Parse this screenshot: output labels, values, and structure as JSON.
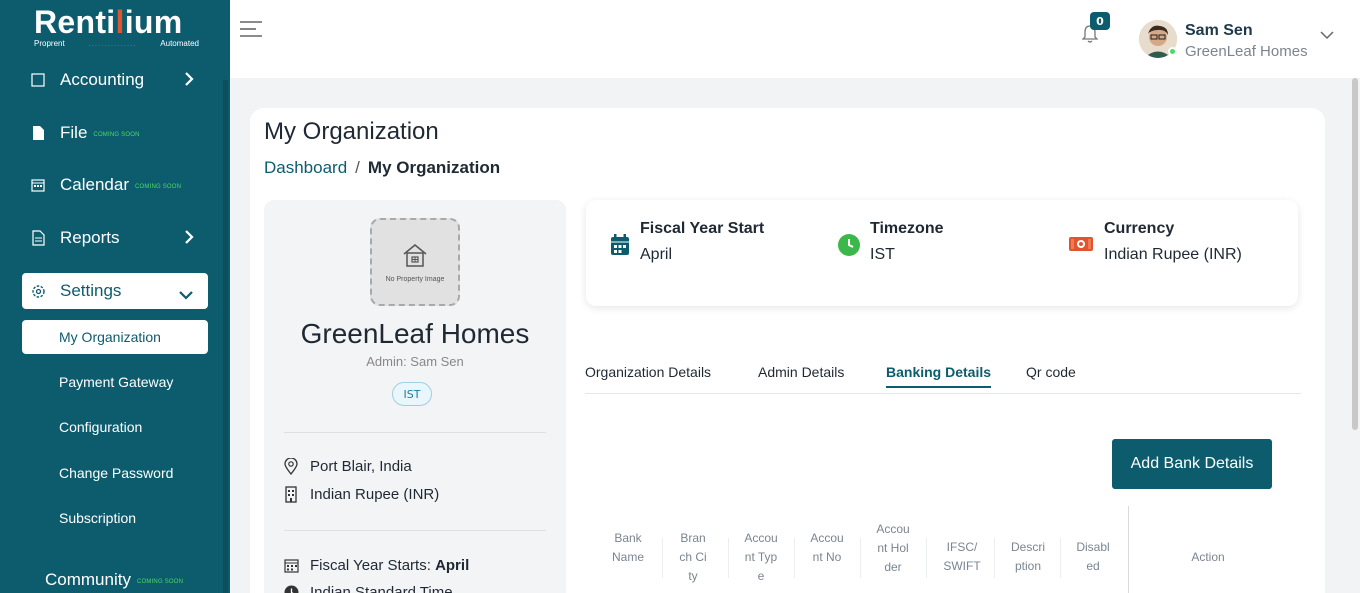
{
  "brand": {
    "name_a": "Renti",
    "name_accent": "l",
    "name_b": "ium",
    "tag_left": "Proprent",
    "tag_dots": "...............",
    "tag_right": "Automated"
  },
  "sidebar": {
    "accounting": "Accounting",
    "file": "File",
    "calendar": "Calendar",
    "reports": "Reports",
    "settings": "Settings",
    "community": "Community",
    "coming_soon": "COMING SOON",
    "sub": [
      "My Organization",
      "Payment Gateway",
      "Configuration",
      "Change Password",
      "Subscription"
    ]
  },
  "header": {
    "notification_count": "0",
    "user_name": "Sam Sen",
    "user_org": "GreenLeaf Homes"
  },
  "page": {
    "title": "My Organization",
    "breadcrumb_root": "Dashboard",
    "breadcrumb_sep": "/",
    "breadcrumb_current": "My Organization"
  },
  "profile": {
    "no_image": "No Property Image",
    "org_name": "GreenLeaf Homes",
    "admin": "Admin: Sam Sen",
    "tz_badge": "IST",
    "location": "Port Blair, India",
    "currency": "Indian Rupee (INR)",
    "fiscal_label": "Fiscal Year Starts:",
    "fiscal_value": "April",
    "timezone_full": "Indian Standard Time"
  },
  "stats": {
    "fiscal_label": "Fiscal Year Start",
    "fiscal_value": "April",
    "tz_label": "Timezone",
    "tz_value": "IST",
    "currency_label": "Currency",
    "currency_value": "Indian Rupee (INR)"
  },
  "tabs": [
    "Organization Details",
    "Admin Details",
    "Banking Details",
    "Qr code"
  ],
  "active_tab": "Banking Details",
  "add_bank_button": "Add Bank Details",
  "table": {
    "headers": [
      "Bank Name",
      "Branch City",
      "Account Type",
      "Account No",
      "Account Holder",
      "IFSC/ SWIFT",
      "Description",
      "Disabled",
      "Action"
    ]
  },
  "colors": {
    "primary": "#0d5c6e",
    "accent": "#e0542e",
    "coming_soon": "#4cd964"
  }
}
